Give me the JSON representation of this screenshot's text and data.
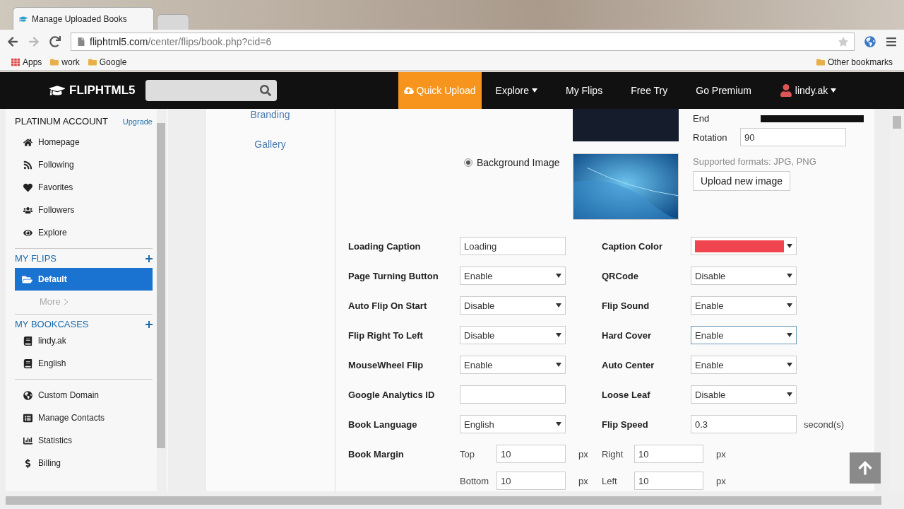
{
  "browser": {
    "tabs": [
      {
        "title": "Manage Uploaded Books",
        "selected": true
      },
      {
        "selected": false
      }
    ],
    "url_host": "fliphtml5.com",
    "url_path": "/center/flips/book.php?cid=6",
    "bookmarks": [
      "Apps",
      "work",
      "Google"
    ],
    "other_bookmarks": "Other bookmarks"
  },
  "header": {
    "logo": "FLIPHTML5",
    "nav": [
      {
        "label": "Quick Upload",
        "kind": "upload"
      },
      {
        "label": "Explore",
        "kind": "menu"
      },
      {
        "label": "My Flips",
        "kind": "link"
      },
      {
        "label": "Free Try",
        "kind": "link"
      },
      {
        "label": "Go Premium",
        "kind": "link"
      }
    ],
    "user": "lindy.ak"
  },
  "sidebar": {
    "account": "PLATINUM ACCOUNT",
    "upgrade": "Upgrade",
    "items": [
      "Homepage",
      "Following",
      "Favorites",
      "Followers",
      "Explore"
    ],
    "flips_title": "MY FLIPS",
    "flips": [
      {
        "label": "Default",
        "selected": true
      }
    ],
    "more": "More",
    "bookcases_title": "MY BOOKCASES",
    "bookcases": [
      "lindy.ak",
      "English"
    ],
    "tools": [
      "Custom Domain",
      "Manage Contacts",
      "Statistics",
      "Billing"
    ]
  },
  "subnav": [
    "Branding",
    "Gallery"
  ],
  "background": {
    "end_label": "End",
    "rotation_label": "Rotation",
    "rotation_value": "90",
    "option_label": "Background Image",
    "option_selected": true,
    "formats": "Supported formats: JPG, PNG",
    "upload_button": "Upload new image"
  },
  "settings": [
    [
      {
        "label": "Loading Caption",
        "kind": "text",
        "value": "Loading",
        "focused": false
      },
      {
        "label": "Caption Color",
        "kind": "color",
        "color": "#f0454f",
        "focused": false
      }
    ],
    [
      {
        "label": "Page Turning Button",
        "kind": "select",
        "value": "Enable",
        "focused": false
      },
      {
        "label": "QRCode",
        "kind": "select",
        "value": "Disable",
        "focused": false
      }
    ],
    [
      {
        "label": "Auto Flip On Start",
        "kind": "select",
        "value": "Disable",
        "focused": false
      },
      {
        "label": "Flip Sound",
        "kind": "select",
        "value": "Enable",
        "focused": false
      }
    ],
    [
      {
        "label": "Flip Right To Left",
        "kind": "select",
        "value": "Disable",
        "focused": false
      },
      {
        "label": "Hard Cover",
        "kind": "select",
        "value": "Enable",
        "focused": true
      }
    ],
    [
      {
        "label": "MouseWheel Flip",
        "kind": "select",
        "value": "Enable",
        "focused": false
      },
      {
        "label": "Auto Center",
        "kind": "select",
        "value": "Enable",
        "focused": false
      }
    ],
    [
      {
        "label": "Google Analytics ID",
        "kind": "text",
        "focused": false
      },
      {
        "label": "Loose Leaf",
        "kind": "select",
        "value": "Disable",
        "focused": false
      }
    ],
    [
      {
        "label": "Book Language",
        "kind": "select",
        "value": "English",
        "focused": false
      },
      {
        "label": "Flip Speed",
        "kind": "text",
        "value": "0.3",
        "unit": "second(s)",
        "focused": false
      }
    ]
  ],
  "margin": {
    "label": "Book Margin",
    "fields": [
      {
        "label": "Top",
        "value": "10",
        "unit": "px"
      },
      {
        "label": "Right",
        "value": "10",
        "unit": "px"
      },
      {
        "label": "Bottom",
        "value": "10",
        "unit": "px"
      },
      {
        "label": "Left",
        "value": "10",
        "unit": "px"
      }
    ]
  }
}
